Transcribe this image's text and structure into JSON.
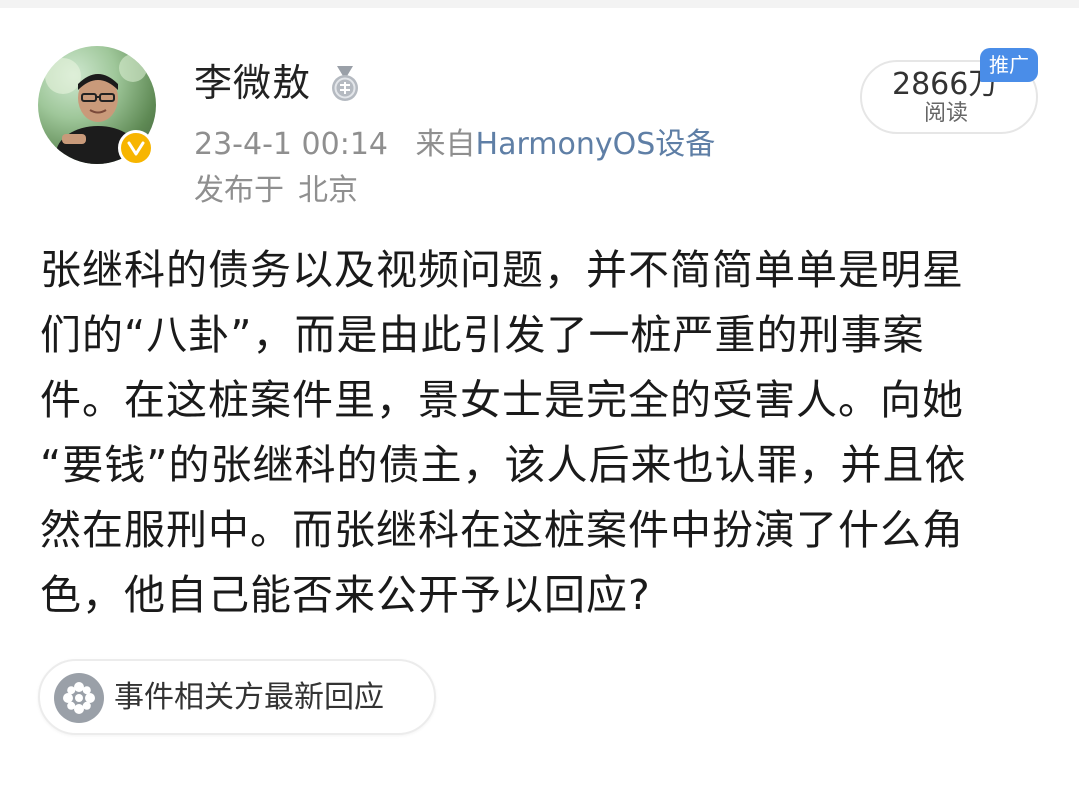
{
  "post": {
    "author": {
      "name": "李微敖",
      "medal_icon": "medal-icon",
      "verified_icon": "verified-v-icon"
    },
    "meta": {
      "timestamp": "23-4-1 00:14",
      "source_prefix": "来自",
      "device": "HarmonyOS设备",
      "location_prefix": "发布于",
      "location": "北京"
    },
    "stats": {
      "reads_count": "2866万",
      "reads_label": "阅读",
      "promo_tag": "推广"
    },
    "content": {
      "lines": [
        "张继科的债务以及视频问题，并不简简单单是明星",
        "们的“八卦”，而是由此引发了一桩严重的刑事案",
        "件。在这桩案件里，景女士是完全的受害人。向她",
        "“要钱”的张继科的债主，该人后来也认罪，并且依",
        "然在服刑中。而张继科在这桩案件中扮演了什么角",
        "色，他自己能否来公开予以回应?"
      ]
    },
    "topic": {
      "label": "事件相关方最新回应",
      "icon": "topic-wheel-icon"
    }
  },
  "colors": {
    "link_blue": "#5f7fa6",
    "meta_gray": "#8f8f8f",
    "verified_gold": "#f7b500",
    "promo_blue": "#4a8de8"
  }
}
